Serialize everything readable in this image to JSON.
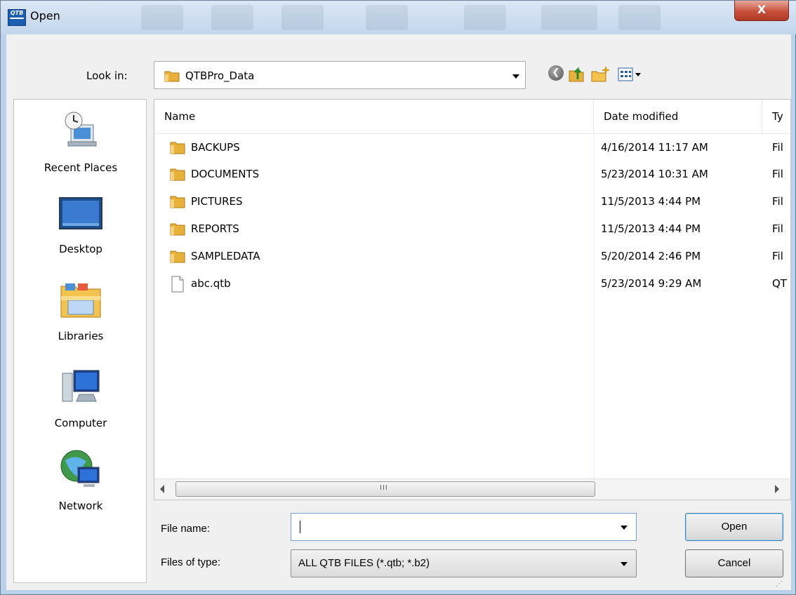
{
  "window": {
    "title": "Open",
    "app_icon_text": "QTB",
    "close_label": "X"
  },
  "toolbar": {
    "look_in_label": "Look in:",
    "look_in_value": "QTBPro_Data"
  },
  "places": [
    {
      "label": "Recent Places",
      "icon": "recent-places-icon"
    },
    {
      "label": "Desktop",
      "icon": "desktop-icon"
    },
    {
      "label": "Libraries",
      "icon": "libraries-icon"
    },
    {
      "label": "Computer",
      "icon": "computer-icon"
    },
    {
      "label": "Network",
      "icon": "network-icon"
    }
  ],
  "columns": {
    "name": "Name",
    "date": "Date modified",
    "type": "Ty"
  },
  "files": [
    {
      "name": "BACKUPS",
      "date": "4/16/2014 11:17 AM",
      "type": "Fil",
      "icon": "folder-icon"
    },
    {
      "name": "DOCUMENTS",
      "date": "5/23/2014 10:31 AM",
      "type": "Fil",
      "icon": "folder-icon"
    },
    {
      "name": "PICTURES",
      "date": "11/5/2013 4:44 PM",
      "type": "Fil",
      "icon": "folder-icon"
    },
    {
      "name": "REPORTS",
      "date": "11/5/2013 4:44 PM",
      "type": "Fil",
      "icon": "folder-icon"
    },
    {
      "name": "SAMPLEDATA",
      "date": "5/20/2014 2:46 PM",
      "type": "Fil",
      "icon": "folder-icon"
    },
    {
      "name": "abc.qtb",
      "date": "5/23/2014 9:29 AM",
      "type": "QT",
      "icon": "file-icon"
    }
  ],
  "scrollbar": {
    "grip": "III"
  },
  "form": {
    "file_name_label": "File name:",
    "file_name_value": "",
    "files_of_type_label": "Files of type:",
    "files_of_type_value": "ALL QTB FILES (*.qtb; *.b2)"
  },
  "buttons": {
    "open": "Open",
    "cancel": "Cancel"
  },
  "colors": {
    "title_bar": "#c2d6ec",
    "close_button": "#c7503b",
    "folder": "#e8b23a",
    "dialog_bg": "#f0f0f0"
  }
}
